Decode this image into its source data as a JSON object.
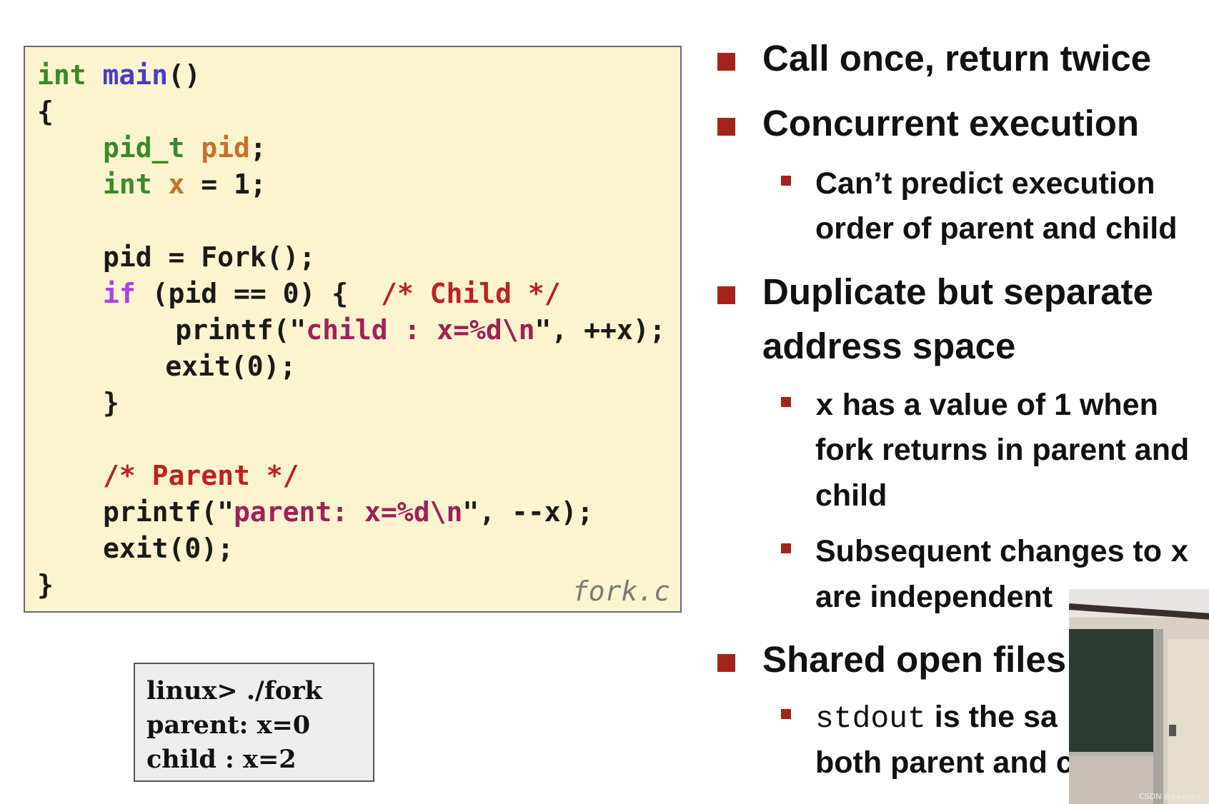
{
  "code": {
    "filename": "fork.c",
    "lines": [
      [
        {
          "t": "int",
          "c": "kw"
        },
        {
          "t": " "
        },
        {
          "t": "main",
          "c": "fn"
        },
        {
          "t": "()"
        }
      ],
      [
        {
          "t": "{"
        }
      ],
      [
        {
          "t": "pid_t",
          "c": "kw"
        },
        {
          "t": " "
        },
        {
          "t": "pid",
          "c": "var"
        },
        {
          "t": ";"
        }
      ],
      [
        {
          "t": "int",
          "c": "kw"
        },
        {
          "t": " "
        },
        {
          "t": "x",
          "c": "var"
        },
        {
          "t": " = 1;"
        }
      ],
      [
        {
          "t": "pid = Fork();"
        }
      ],
      [
        {
          "t": "if",
          "c": "ctl"
        },
        {
          "t": " (pid == 0) {  "
        },
        {
          "t": "/* Child */",
          "c": "cm"
        }
      ],
      [
        {
          "t": "printf(\""
        },
        {
          "t": "child : x=%d\\n",
          "c": "str"
        },
        {
          "t": "\", ++x);"
        }
      ],
      [
        {
          "t": "exit(0);"
        }
      ],
      [
        {
          "t": "}"
        }
      ],
      [
        {
          "t": "/* Parent */",
          "c": "cm"
        }
      ],
      [
        {
          "t": "printf(\""
        },
        {
          "t": "parent: x=%d\\n",
          "c": "str"
        },
        {
          "t": "\", --x);"
        }
      ],
      [
        {
          "t": "exit(0);"
        }
      ],
      [
        {
          "t": "}"
        }
      ]
    ]
  },
  "terminal": {
    "lines": [
      "linux> ./fork",
      "parent: x=0",
      "child : x=2"
    ]
  },
  "bullets": {
    "b1": "Call once, return twice",
    "b2": "Concurrent execution",
    "b2_sub1_l1": "Can’t predict execution",
    "b2_sub1_l2": "order of parent and child",
    "b3_l1": "Duplicate but separate",
    "b3_l2": "address space",
    "b3_sub1_x": "x",
    "b3_sub1_l1": " has a value of 1 when",
    "b3_sub1_l2": "fork returns in parent and",
    "b3_sub1_l3": "child",
    "b3_sub2_l1": "Subsequent changes to ",
    "b3_sub2_x": "x",
    "b3_sub2_l2": "are independent",
    "b4": "Shared open files",
    "b4_sub1_mono": "stdout",
    "b4_sub1_l1": " is the sa",
    "b4_sub1_l2": "both parent and c"
  },
  "accent_color": "#a3241d",
  "watermark": "CSDN @Eeeeye_"
}
